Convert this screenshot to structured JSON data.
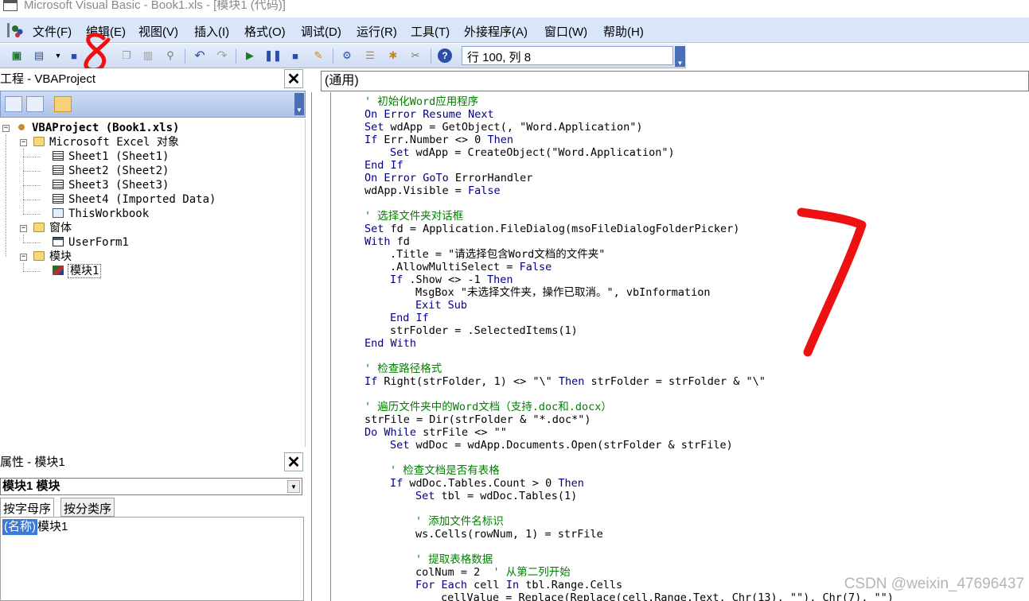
{
  "window": {
    "title": "Microsoft Visual Basic - Book1.xls - [模块1 (代码)]"
  },
  "menu": [
    "文件(F)",
    "编辑(E)",
    "视图(V)",
    "插入(I)",
    "格式(O)",
    "调试(D)",
    "运行(R)",
    "工具(T)",
    "外接程序(A)",
    "窗口(W)",
    "帮助(H)"
  ],
  "toolbar": {
    "status": "行 100, 列 8",
    "icons": [
      "view-excel-icon",
      "insert-module-icon",
      "save-icon",
      "cut-icon",
      "copy-icon",
      "paste-icon",
      "find-icon",
      "undo-icon",
      "redo-icon",
      "run-icon",
      "break-icon",
      "reset-icon",
      "design-mode-icon",
      "project-explorer-icon",
      "properties-icon",
      "object-browser-icon",
      "toolbox-icon",
      "help-icon"
    ]
  },
  "project_panel": {
    "title": "工程 - VBAProject",
    "tree": {
      "root": "VBAProject (Book1.xls)",
      "excel_folder": "Microsoft Excel 对象",
      "sheets": [
        "Sheet1 (Sheet1)",
        "Sheet2 (Sheet2)",
        "Sheet3 (Sheet3)",
        "Sheet4 (Imported Data)"
      ],
      "workbook": "ThisWorkbook",
      "forms_folder": "窗体",
      "userform": "UserForm1",
      "modules_folder": "模块",
      "module": "模块1"
    }
  },
  "properties_panel": {
    "title": "属性 - 模块1",
    "object": "模块1 模块",
    "tabs": [
      "按字母序",
      "按分类序"
    ],
    "row": {
      "key": "(名称)",
      "value": "模块1"
    }
  },
  "code_editor": {
    "procedure": "(通用)",
    "lines": [
      {
        "text": "' 初始化Word应用程序",
        "type": "comment",
        "indent": 0
      },
      {
        "text": "On Error Resume Next",
        "type": "keyword",
        "indent": 0
      },
      {
        "text": "Set wdApp = GetObject(, \"Word.Application\")",
        "type": "mixed",
        "indent": 0
      },
      {
        "text": "If Err.Number <> 0 Then",
        "type": "mixed",
        "indent": 0
      },
      {
        "text": "Set wdApp = CreateObject(\"Word.Application\")",
        "type": "mixed",
        "indent": 1
      },
      {
        "text": "End If",
        "type": "keyword",
        "indent": 0
      },
      {
        "text": "On Error GoTo ErrorHandler",
        "type": "mixed",
        "indent": 0
      },
      {
        "text": "wdApp.Visible = False",
        "type": "mixed",
        "indent": 0
      },
      {
        "text": "",
        "type": "blank",
        "indent": 0
      },
      {
        "text": "' 选择文件夹对话框",
        "type": "comment",
        "indent": 0
      },
      {
        "text": "Set fd = Application.FileDialog(msoFileDialogFolderPicker)",
        "type": "mixed",
        "indent": 0
      },
      {
        "text": "With fd",
        "type": "mixed",
        "indent": 0
      },
      {
        "text": ".Title = \"请选择包含Word文档的文件夹\"",
        "type": "plain",
        "indent": 1
      },
      {
        "text": ".AllowMultiSelect = False",
        "type": "mixed",
        "indent": 1
      },
      {
        "text": "If .Show <> -1 Then",
        "type": "mixed",
        "indent": 1
      },
      {
        "text": "MsgBox \"未选择文件夹，操作已取消。\", vbInformation",
        "type": "plain",
        "indent": 2
      },
      {
        "text": "Exit Sub",
        "type": "keyword",
        "indent": 2
      },
      {
        "text": "End If",
        "type": "keyword",
        "indent": 1
      },
      {
        "text": "strFolder = .SelectedItems(1)",
        "type": "plain",
        "indent": 1
      },
      {
        "text": "End With",
        "type": "keyword",
        "indent": 0
      },
      {
        "text": "",
        "type": "blank",
        "indent": 0
      },
      {
        "text": "' 检查路径格式",
        "type": "comment",
        "indent": 0
      },
      {
        "text": "If Right(strFolder, 1) <> \"\\\" Then strFolder = strFolder & \"\\\"",
        "type": "mixed",
        "indent": 0
      },
      {
        "text": "",
        "type": "blank",
        "indent": 0
      },
      {
        "text": "' 遍历文件夹中的Word文档（支持.doc和.docx）",
        "type": "comment",
        "indent": 0
      },
      {
        "text": "strFile = Dir(strFolder & \"*.doc*\")",
        "type": "plain",
        "indent": 0
      },
      {
        "text": "Do While strFile <> \"\"",
        "type": "mixed",
        "indent": 0
      },
      {
        "text": "Set wdDoc = wdApp.Documents.Open(strFolder & strFile)",
        "type": "mixed",
        "indent": 1
      },
      {
        "text": "",
        "type": "blank",
        "indent": 0
      },
      {
        "text": "' 检查文档是否有表格",
        "type": "comment",
        "indent": 1
      },
      {
        "text": "If wdDoc.Tables.Count > 0 Then",
        "type": "mixed",
        "indent": 1
      },
      {
        "text": "Set tbl = wdDoc.Tables(1)",
        "type": "mixed",
        "indent": 2
      },
      {
        "text": "",
        "type": "blank",
        "indent": 0
      },
      {
        "text": "' 添加文件名标识",
        "type": "comment",
        "indent": 2
      },
      {
        "text": "ws.Cells(rowNum, 1) = strFile",
        "type": "plain",
        "indent": 2
      },
      {
        "text": "",
        "type": "blank",
        "indent": 0
      },
      {
        "text": "' 提取表格数据",
        "type": "comment",
        "indent": 2
      },
      {
        "text": "colNum = 2  ' 从第二列开始",
        "type": "mixed",
        "indent": 2
      },
      {
        "text": "For Each cell In tbl.Range.Cells",
        "type": "mixed",
        "indent": 2
      },
      {
        "text": "cellValue = Replace(Replace(cell.Range.Text, Chr(13), \"\"), Chr(7), \"\")",
        "type": "plain",
        "indent": 3
      }
    ]
  },
  "annotations": {
    "mark_8": "8",
    "mark_7": "7"
  },
  "watermark": "CSDN @weixin_47696437"
}
